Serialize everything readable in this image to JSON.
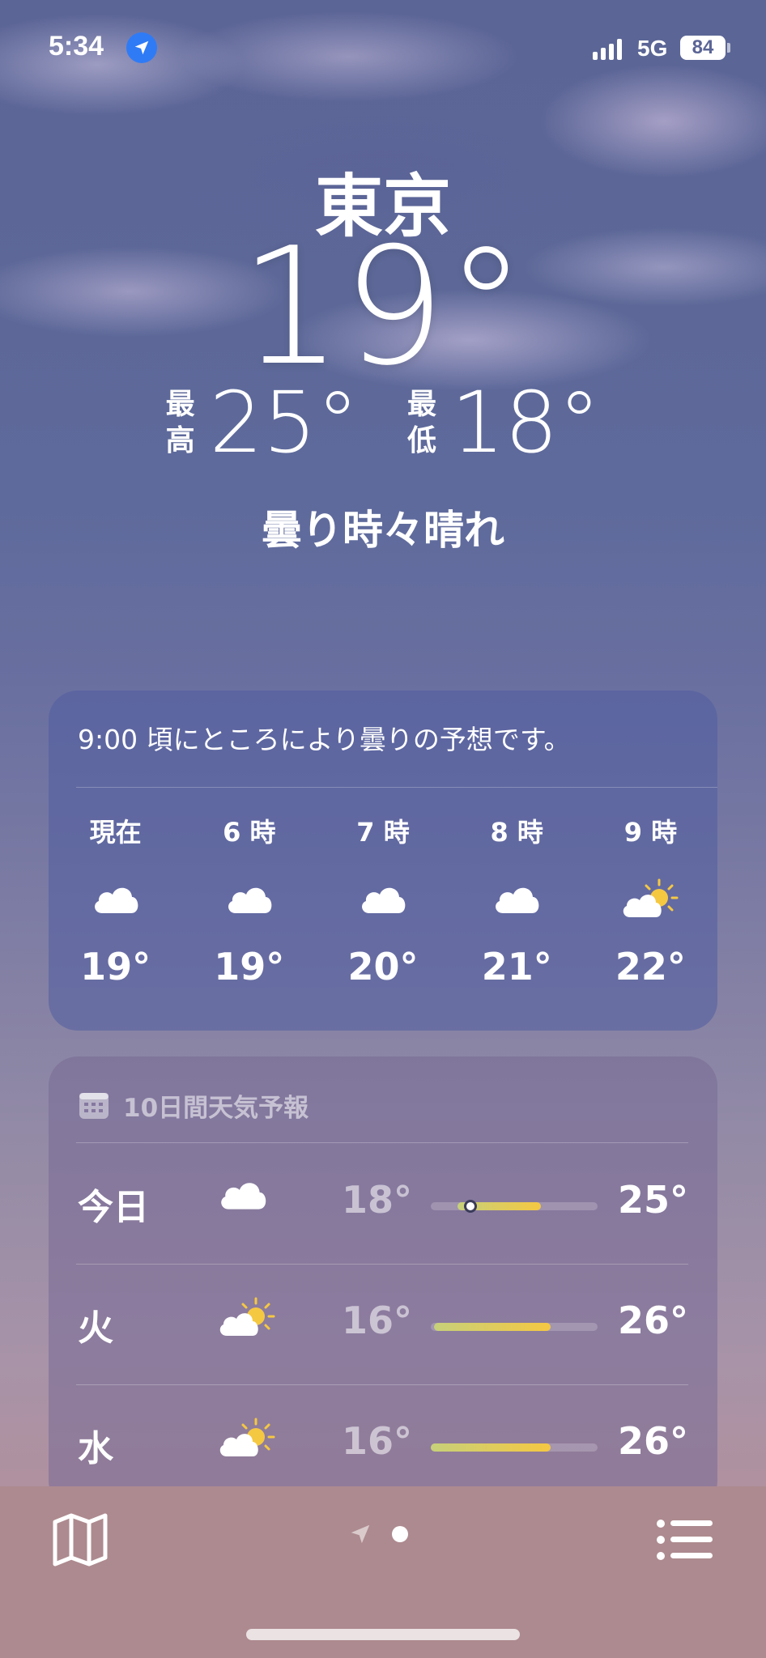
{
  "status_bar": {
    "time": "5:34",
    "network": "5G",
    "battery": "84",
    "location_icon": "location-arrow-icon",
    "signal_icon": "signal-bars-icon"
  },
  "hero": {
    "city": "東京",
    "temperature": "19°",
    "high_label_1": "最",
    "high_label_2": "高",
    "high_value": "25°",
    "low_label_1": "最",
    "low_label_2": "低",
    "low_value": "18°",
    "condition": "曇り時々晴れ"
  },
  "hourly": {
    "summary": "9:00 頃にところにより曇りの予想です。",
    "items": [
      {
        "label": "現在",
        "icon": "cloud-icon",
        "temp": "19°"
      },
      {
        "label": "6 時",
        "icon": "cloud-icon",
        "temp": "19°"
      },
      {
        "label": "7 時",
        "icon": "cloud-icon",
        "temp": "20°"
      },
      {
        "label": "8 時",
        "icon": "cloud-icon",
        "temp": "21°"
      },
      {
        "label": "9 時",
        "icon": "partly-sunny-icon",
        "temp": "22°"
      }
    ]
  },
  "daily": {
    "header": "10日間天気予報",
    "header_icon": "calendar-icon",
    "items": [
      {
        "day": "今日",
        "icon": "cloud-icon",
        "low": "18°",
        "high": "25°",
        "range_start": 0.16,
        "range_end": 0.66,
        "current": 0.24
      },
      {
        "day": "火",
        "icon": "partly-sunny-icon",
        "low": "16°",
        "high": "26°",
        "range_start": 0.02,
        "range_end": 0.72
      },
      {
        "day": "水",
        "icon": "partly-sunny-icon",
        "low": "16°",
        "high": "26°",
        "range_start": 0.0,
        "range_end": 0.72
      }
    ]
  },
  "bottom_bar": {
    "map_icon": "map-icon",
    "location_page_icon": "location-arrow-icon",
    "page_dot": "page-dot",
    "list_icon": "list-icon"
  },
  "colors": {
    "accent": "#2f7bf6",
    "sun": "#f5c842",
    "bar_start": "#c7d07a",
    "bar_end": "#f5c842"
  }
}
